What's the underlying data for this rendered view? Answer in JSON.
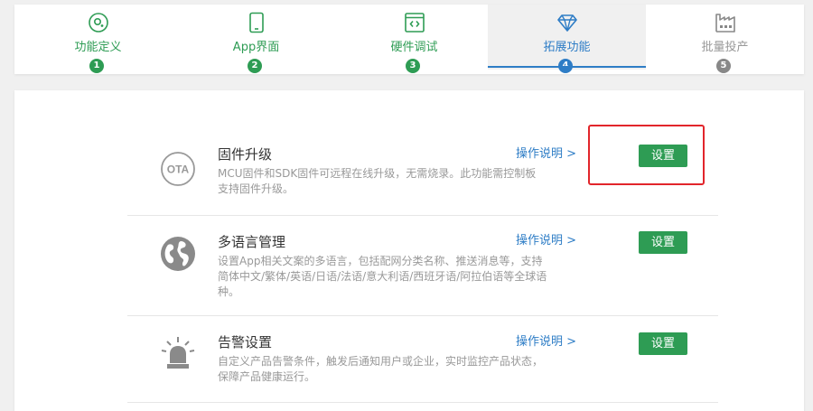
{
  "steps": [
    {
      "label": "功能定义",
      "num": "1",
      "icon": "gear-icon"
    },
    {
      "label": "App界面",
      "num": "2",
      "icon": "phone-icon"
    },
    {
      "label": "硬件调试",
      "num": "3",
      "icon": "code-icon"
    },
    {
      "label": "拓展功能",
      "num": "4",
      "icon": "diamond-icon"
    },
    {
      "label": "批量投产",
      "num": "5",
      "icon": "factory-icon"
    }
  ],
  "colors": {
    "green": "#2e9c54",
    "blue": "#2e7dc6",
    "gray": "#999999",
    "red": "#e2252b"
  },
  "features": [
    {
      "title": "固件升级",
      "desc_1": "MCU固件和SDK固件可远程在线升级，无需烧录。此功能需控制板",
      "desc_2": "支持固件升级。",
      "link": "操作说明 >",
      "button": "设置",
      "icon": "ota-icon"
    },
    {
      "title": "多语言管理",
      "desc_1": "设置App相关文案的多语言，包括配网分类名称、推送消息等，支持",
      "desc_2": "简体中文/繁体/英语/日语/法语/意大利语/西班牙语/阿拉伯语等全球语",
      "desc_3": "种。",
      "link": "操作说明 >",
      "button": "设置",
      "icon": "globe-icon"
    },
    {
      "title": "告警设置",
      "desc_1": "自定义产品告警条件，触发后通知用户或企业，实时监控产品状态，",
      "desc_2": "保障产品健康运行。",
      "link": "操作说明 >",
      "button": "设置",
      "icon": "alarm-icon"
    }
  ]
}
